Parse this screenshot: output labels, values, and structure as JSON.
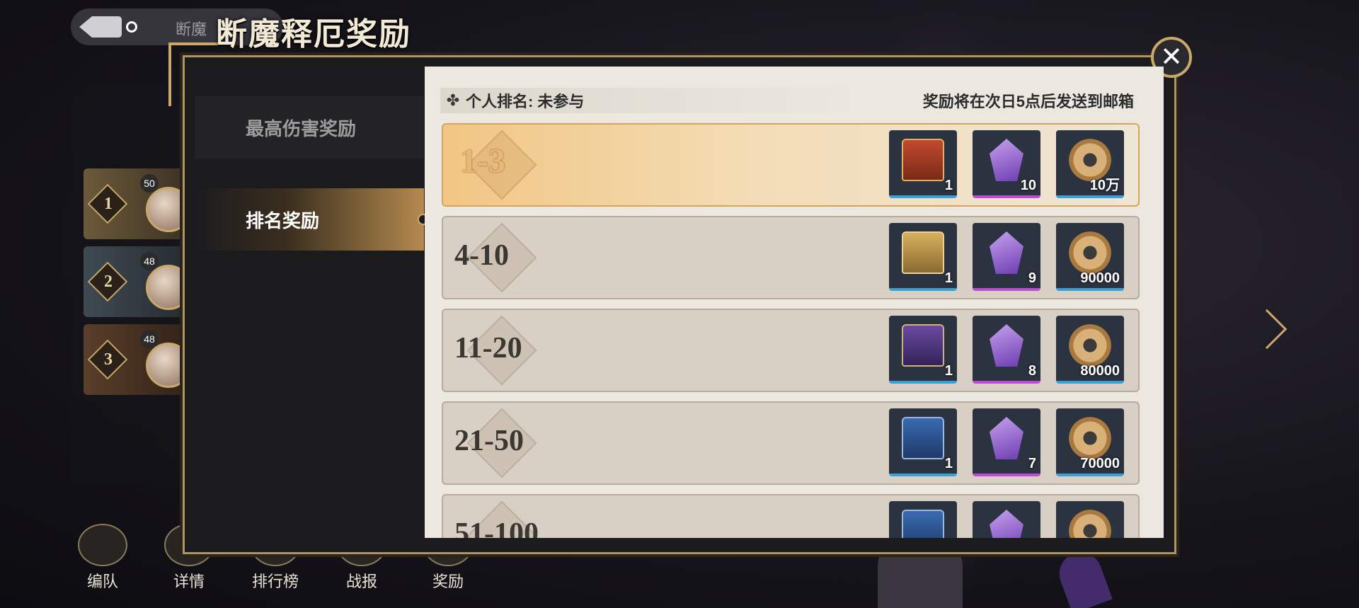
{
  "window": {
    "title": "断魔释厄奖励",
    "behind_title": "断魔"
  },
  "tabs": [
    {
      "label": "最高伤害奖励",
      "active": false
    },
    {
      "label": "排名奖励",
      "active": true
    }
  ],
  "info_bar": {
    "label": "个人排名:",
    "value": "未参与",
    "note": "奖励将在次日5点后发送到邮箱"
  },
  "rewards": [
    {
      "rank": "1-3",
      "items": [
        {
          "icon": "chest-red-icon",
          "qty": "1"
        },
        {
          "icon": "crystal-icon",
          "qty": "10"
        },
        {
          "icon": "gear-coin-icon",
          "qty": "10万"
        }
      ]
    },
    {
      "rank": "4-10",
      "items": [
        {
          "icon": "chest-gold-icon",
          "qty": "1"
        },
        {
          "icon": "crystal-icon",
          "qty": "9"
        },
        {
          "icon": "gear-coin-icon",
          "qty": "90000"
        }
      ]
    },
    {
      "rank": "11-20",
      "items": [
        {
          "icon": "chest-purple-icon",
          "qty": "1"
        },
        {
          "icon": "crystal-icon",
          "qty": "8"
        },
        {
          "icon": "gear-coin-icon",
          "qty": "80000"
        }
      ]
    },
    {
      "rank": "21-50",
      "items": [
        {
          "icon": "chest-blue-icon",
          "qty": "1"
        },
        {
          "icon": "crystal-icon",
          "qty": "7"
        },
        {
          "icon": "gear-coin-icon",
          "qty": "70000"
        }
      ]
    },
    {
      "rank": "51-100",
      "items": [
        {
          "icon": "chest-blue-icon",
          "qty": ""
        },
        {
          "icon": "crystal-icon",
          "qty": ""
        },
        {
          "icon": "gear-coin-icon",
          "qty": ""
        }
      ]
    }
  ],
  "leaderboard_preview": [
    {
      "rank": "1",
      "level": "50"
    },
    {
      "rank": "2",
      "level": "48"
    },
    {
      "rank": "3",
      "level": "48"
    }
  ],
  "bottom_nav": [
    "编队",
    "详情",
    "排行榜",
    "战报",
    "奖励"
  ],
  "colors": {
    "accent_gold": "#c9a86a",
    "top_row": "#f2c684",
    "panel_dark": "#1b1b1e"
  }
}
